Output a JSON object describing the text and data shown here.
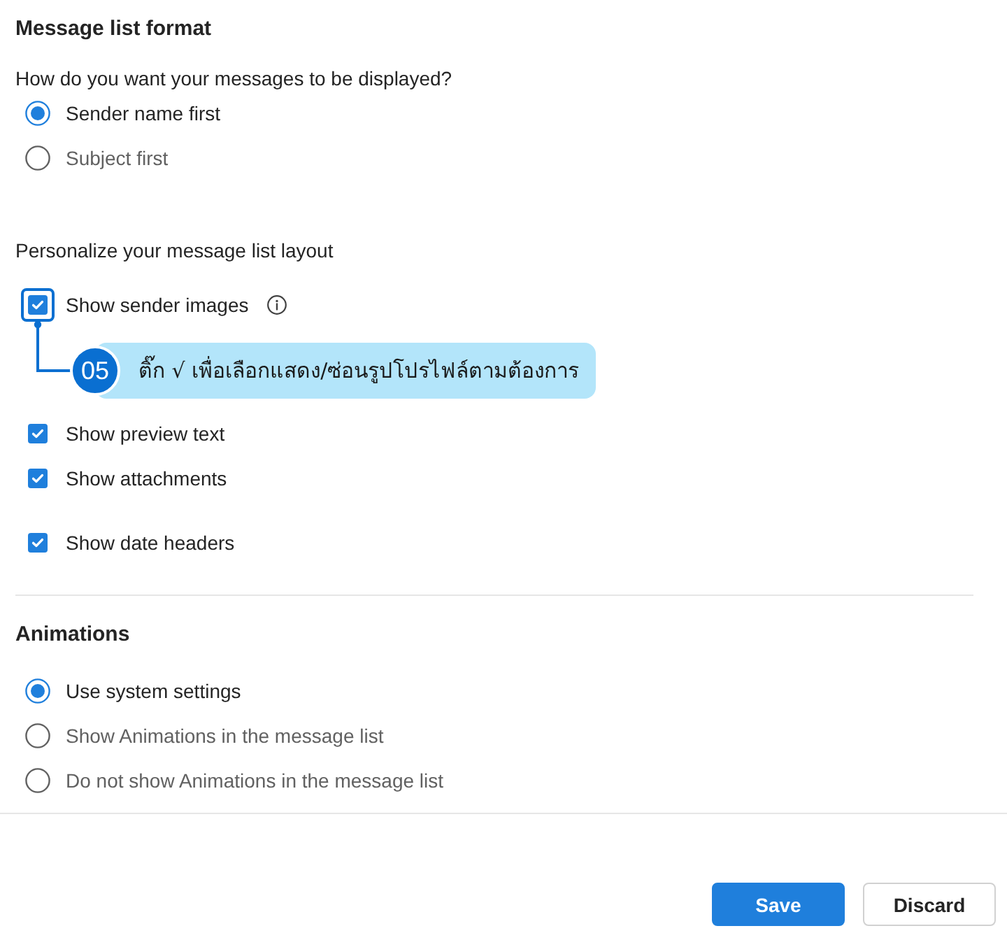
{
  "message_list_format": {
    "title": "Message list format",
    "question": "How do you want your messages to be displayed?",
    "options": [
      {
        "label": "Sender name first",
        "selected": true
      },
      {
        "label": "Subject first",
        "selected": false
      }
    ]
  },
  "personalize": {
    "heading": "Personalize your message list layout",
    "options": [
      {
        "label": "Show sender images",
        "checked": true,
        "info": true,
        "highlighted": true
      },
      {
        "label": "Show preview text",
        "checked": true,
        "info": false,
        "highlighted": false
      },
      {
        "label": "Show attachments",
        "checked": true,
        "info": false,
        "highlighted": false
      },
      {
        "label": "Show date headers",
        "checked": true,
        "info": false,
        "highlighted": false
      }
    ]
  },
  "annotation": {
    "step": "05",
    "text": "ติ๊ก √ เพื่อเลือกแสดง/ซ่อนรูปโปรไฟล์ตามต้องการ"
  },
  "animations": {
    "title": "Animations",
    "options": [
      {
        "label": "Use system settings",
        "selected": true
      },
      {
        "label": "Show Animations in the message list",
        "selected": false
      },
      {
        "label": "Do not show Animations in the message list",
        "selected": false
      }
    ]
  },
  "buttons": [
    {
      "label": "Save",
      "kind": "primary"
    },
    {
      "label": "Discard",
      "kind": "secondary"
    }
  ]
}
